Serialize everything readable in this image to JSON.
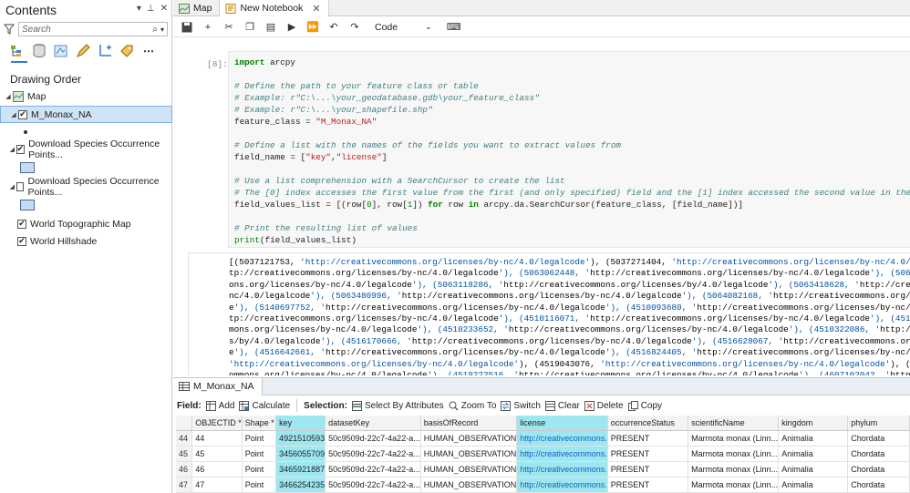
{
  "contents": {
    "title": "Contents",
    "search_placeholder": "Search",
    "drawing_order_label": "Drawing Order",
    "tree": [
      {
        "label": "Map",
        "type": "map"
      },
      {
        "label": "M_Monax_NA",
        "type": "layer",
        "checked": true,
        "selected": true
      },
      {
        "label": "Download Species Occurrence Points...",
        "type": "layer",
        "checked": true
      },
      {
        "label": "Download Species Occurrence Points...",
        "type": "layer",
        "checked": false
      },
      {
        "label": "World Topographic Map",
        "type": "basemap",
        "checked": true
      },
      {
        "label": "World Hillshade",
        "type": "basemap",
        "checked": true
      }
    ]
  },
  "tabs": [
    {
      "label": "Map",
      "icon": "map-icon",
      "active": false
    },
    {
      "label": "New Notebook",
      "icon": "notebook-icon",
      "active": true
    }
  ],
  "notebook": {
    "cell_type": "Code",
    "prompt": "[8]:",
    "code_lines": [
      "import arcpy",
      "",
      "# Define the path to your feature class or table",
      "# Example: r\"C:\\...\\your_geodatabase.gdb\\your_feature_class\"",
      "# Example: r\"C:\\...\\your_shapefile.shp\"",
      "feature_class = \"M_Monax_NA\"",
      "",
      "# Define a list with the names of the fields you want to extract values from",
      "field_name = [\"key\",\"license\"]",
      "",
      "# Use a list comprehension with a SearchCursor to create the list",
      "# The [0] index accesses the first value from the first (and only specified) field and the [1] index accessed the second value in the row tuple",
      "field_values_list = [(row[0], row[1]) for row in arcpy.da.SearchCursor(feature_class, [field_name])]",
      "",
      "# Print the resulting list of values",
      "print(field_values_list)"
    ],
    "output_lines": [
      "[(5037121753, 'http://creativecommons.org/licenses/by-nc/4.0/legalcode'), (5037271404, 'http://creativecommons.org/licenses/by-nc/4.0/legalcode'), (5037",
      "tp://creativecommons.org/licenses/by-nc/4.0/legalcode'), (5063062448, 'http://creativecommons.org/licenses/by-nc/4.0/legalcode'), (5063109519, 'http://creative",
      "ons.org/licenses/by-nc/4.0/legalcode'), (5063118286, 'http://creativecommons.org/licenses/by/4.0/legalcode'), (5063418628, 'http://creativecommons.org/licen",
      "nc/4.0/legalcode'), (5063480996, 'http://creativecommons.org/licenses/by-nc/4.0/legalcode'), (5064082168, 'http://creativecommons.org/licenses/by-",
      "e'), (5140697752, 'http://creativecommons.org/licenses/by-nc/4.0/legalcode'), (4510093680, 'http://creativecommons.org/licenses/by-nc/4.0/legalcode'), (4",
      "tp://creativecommons.org/licenses/by-nc/4.0/legalcode'), (4510116071, 'http://creativecommons.org/licenses/by-nc/4.0/legalcode'), (4510145059, 'http://creati",
      "mons.org/licenses/by-nc/4.0/legalcode'), (4510233652, 'http://creativecommons.org/licenses/by-nc/4.0/legalcode'), (4510322086, 'http://creativecommons.org/licen",
      "s/by/4.0/legalcode'), (4516170666, 'http://creativecommons.org/licenses/by-nc/4.0/legalcode'), (4516628067, 'http://creativecommons.org/licenses/by",
      "e'), (4516642661, 'http://creativecommons.org/licenses/by-nc/4.0/legalcode'), (4516824405, 'http://creativecommons.org/licenses/by-nc/4.0/legalcode",
      "'http://creativecommons.org/licenses/by-nc/4.0/legalcode'), (4519043076, 'http://creativecommons.org/licenses/by-nc/4.0/legalcode'), (4519094049, 'http://creati",
      "ommons.org/licenses/by-nc/4.0/legalcode'), (4519222516, 'http://creativecommons.org/licenses/by-nc/4.0/legalcode'), (4607102042, 'http://creativecommons.o"
    ]
  },
  "attribute_table": {
    "tab_label": "M_Monax_NA",
    "field_label": "Field:",
    "add_label": "Add",
    "calculate_label": "Calculate",
    "selection_label": "Selection:",
    "select_by_attributes_label": "Select By Attributes",
    "zoom_to_label": "Zoom To",
    "switch_label": "Switch",
    "clear_label": "Clear",
    "delete_label": "Delete",
    "copy_label": "Copy",
    "columns": [
      "OBJECTID *",
      "Shape *",
      "key",
      "datasetKey",
      "basisOfRecord",
      "license",
      "occurrenceStatus",
      "scientificName",
      "kingdom",
      "phylum"
    ],
    "rows": [
      {
        "rownum": "44",
        "cells": [
          "44",
          "Point",
          "4921510593",
          "50c9509d-22c7-4a22-a...",
          "HUMAN_OBSERVATION",
          "http://creativecommons.",
          "PRESENT",
          "Marmota monax (Linn...",
          "Animalia",
          "Chordata"
        ]
      },
      {
        "rownum": "45",
        "cells": [
          "45",
          "Point",
          "3456055709",
          "50c9509d-22c7-4a22-a...",
          "HUMAN_OBSERVATION",
          "http://creativecommons.",
          "PRESENT",
          "Marmota monax (Linn...",
          "Animalia",
          "Chordata"
        ]
      },
      {
        "rownum": "46",
        "cells": [
          "46",
          "Point",
          "3465921887",
          "50c9509d-22c7-4a22-a...",
          "HUMAN_OBSERVATION",
          "http://creativecommons.",
          "PRESENT",
          "Marmota monax (Linn...",
          "Animalia",
          "Chordata"
        ]
      },
      {
        "rownum": "47",
        "cells": [
          "47",
          "Point",
          "3466254235",
          "50c9509d-22c7-4a22-a...",
          "HUMAN_OBSERVATION",
          "http://creativecommons.",
          "PRESENT",
          "Marmota monax (Linn...",
          "Animalia",
          "Chordata"
        ]
      }
    ]
  },
  "colors": {
    "selection_highlight": "#9ee7f0",
    "tree_selected": "#cfe3f7",
    "accent": "#2e7cd6"
  }
}
